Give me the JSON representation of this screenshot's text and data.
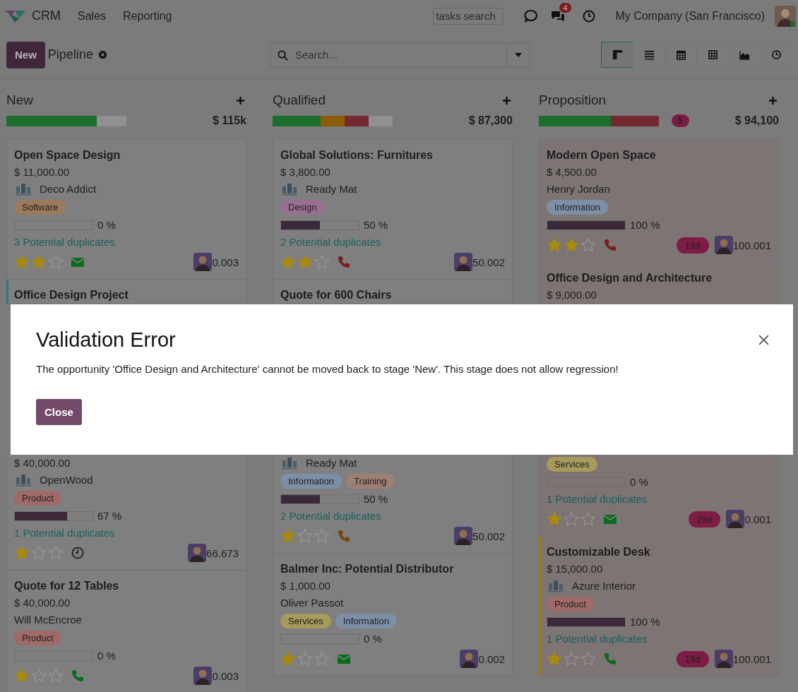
{
  "nav": {
    "app": "CRM",
    "menus": [
      "Sales",
      "Reporting"
    ],
    "search_placeholder": "tasks search",
    "message_count": "4",
    "company": "My Company (San Francisco)"
  },
  "control": {
    "new_button": "New",
    "title": "Pipeline",
    "search_placeholder": "Search...",
    "views": [
      {
        "kind": "kanban",
        "selected": true
      },
      {
        "kind": "list",
        "selected": false
      },
      {
        "kind": "calendar",
        "selected": false
      },
      {
        "kind": "pivot",
        "selected": false
      },
      {
        "kind": "graph",
        "selected": false
      },
      {
        "kind": "activity",
        "selected": false
      }
    ]
  },
  "columns": [
    {
      "name": "New",
      "total": "$ 115k",
      "progress": [
        {
          "color": "#1c6e2d",
          "level": 0.75
        },
        {
          "color": "#909090"
        }
      ],
      "cards_above": [
        {
          "title": "Open Space Design",
          "amount": "$ 11,000.00",
          "partner": "Deco Addict",
          "logo": true,
          "tags": [
            {
              "label": "Software",
              "color": "#9c7a5c"
            }
          ],
          "probability": {
            "level": 0,
            "text": "0 %"
          },
          "duplicates": "3 Potential duplicates",
          "stars": 2,
          "activity": {
            "kind": "mail",
            "color": "#0b6a1c"
          },
          "score": "0.003"
        },
        {
          "title": "Office Design Project",
          "color": "#2c7a78"
        }
      ],
      "cards_below": [
        {
          "amount": "$ 40,000.00",
          "partner": "OpenWood",
          "logo": true,
          "tags": [
            {
              "label": "Product",
              "color": "#a06a68"
            }
          ],
          "probability": {
            "level": 0.67,
            "text": "67 %"
          },
          "duplicates": "1 Potential duplicates",
          "stars": 1,
          "activity": {
            "kind": "clock",
            "color": "#2a2a2a"
          },
          "score": "66.673"
        },
        {
          "title": "Quote for 12 Tables",
          "amount": "$ 40,000.00",
          "partner": "Will McEncroe",
          "logo": false,
          "tags": [
            {
              "label": "Product",
              "color": "#a06a68"
            }
          ],
          "probability": {
            "level": 0,
            "text": "0 %"
          },
          "stars": 1,
          "activity": {
            "kind": "phone",
            "color": "#0b6a1c"
          },
          "score": "0.003"
        }
      ]
    },
    {
      "name": "Qualified",
      "total": "$ 87,300",
      "progress": [
        {
          "color": "#1c6e2d",
          "level": 0.4
        },
        {
          "color": "#8a5e08"
        },
        {
          "color": "#742830"
        },
        {
          "color": "#909090"
        }
      ],
      "cards_above": [
        {
          "title": "Global Solutions: Furnitures",
          "amount": "$ 3,800.00",
          "partner": "Ready Mat",
          "logo": true,
          "tags": [
            {
              "label": "Design",
              "color": "#9a6e90"
            }
          ],
          "probability": {
            "level": 0.5,
            "text": "50 %"
          },
          "duplicates": "2 Potential duplicates",
          "stars": 2,
          "activity": {
            "kind": "phone",
            "color": "#7a1d1d"
          },
          "score": "50.002"
        },
        {
          "title": "Quote for 600 Chairs"
        }
      ],
      "cards_below": [
        {
          "partner": "Ready Mat",
          "logo": true,
          "tags": [
            {
              "label": "Information",
              "color": "#7d8fa6"
            },
            {
              "label": "Training",
              "color": "#9e7f74"
            }
          ],
          "probability": {
            "level": 0.5,
            "text": "50 %"
          },
          "duplicates": "2 Potential duplicates",
          "stars": 1,
          "activity": {
            "kind": "phone",
            "color": "#6e4a08"
          },
          "score": "50.002"
        },
        {
          "title": "Balmer Inc: Potential Distributor",
          "amount": "$ 1,000.00",
          "partner": "Oliver Passot",
          "logo": false,
          "tags": [
            {
              "label": "Services",
              "color": "#a69a5c"
            },
            {
              "label": "Information",
              "color": "#7d8fa6"
            }
          ],
          "probability": {
            "level": 0,
            "text": "0 %"
          },
          "stars": 1,
          "activity": {
            "kind": "mail",
            "color": "#0b6a1c"
          },
          "score": "0.002"
        }
      ]
    },
    {
      "name": "Proposition",
      "count": "5",
      "total": "$ 94,100",
      "progress": [
        {
          "color": "#1c6e2d",
          "level": 0.6
        },
        {
          "color": "#742830"
        }
      ],
      "cards_above": [
        {
          "title": "Modern Open Space",
          "amount": "$ 4,500.00",
          "partner": "Henry Jordan",
          "logo": false,
          "tags": [
            {
              "label": "Information",
              "color": "#7d8fa6"
            }
          ],
          "probability": {
            "level": 1,
            "text": "100 %"
          },
          "stars": 2,
          "activity": {
            "kind": "phone",
            "color": "#7a1d1d"
          },
          "overdue": "19d",
          "score": "100.001"
        },
        {
          "title": "Office Design and Architecture",
          "amount": "$ 9,000.00"
        }
      ],
      "cards_below": [
        {
          "tags": [
            {
              "label": "Services",
              "color": "#a69a5c"
            }
          ],
          "probability": {
            "level": 0,
            "text": "0 %"
          },
          "duplicates": "1 Potential duplicates",
          "stars": 1,
          "activity": {
            "kind": "mail",
            "color": "#0b6a1c"
          },
          "overdue": "25d",
          "score": "0.001"
        },
        {
          "title": "Customizable Desk",
          "color": "#9a7d0a",
          "amount": "$ 15,000.00",
          "partner": "Azure Interior",
          "logo": true,
          "tags": [
            {
              "label": "Product",
              "color": "#a06a68"
            }
          ],
          "probability": {
            "level": 1,
            "text": "100 %"
          },
          "duplicates": "1 Potential duplicates",
          "stars": 1,
          "activity": {
            "kind": "phone",
            "color": "#0b6a1c"
          },
          "overdue": "19d",
          "score": "100.001"
        }
      ]
    }
  ],
  "dialog": {
    "title": "Validation Error",
    "message": "The opportunity 'Office Design and Architecture' cannot be moved back to stage 'New'. This stage does not allow regression!",
    "button": "Close"
  }
}
